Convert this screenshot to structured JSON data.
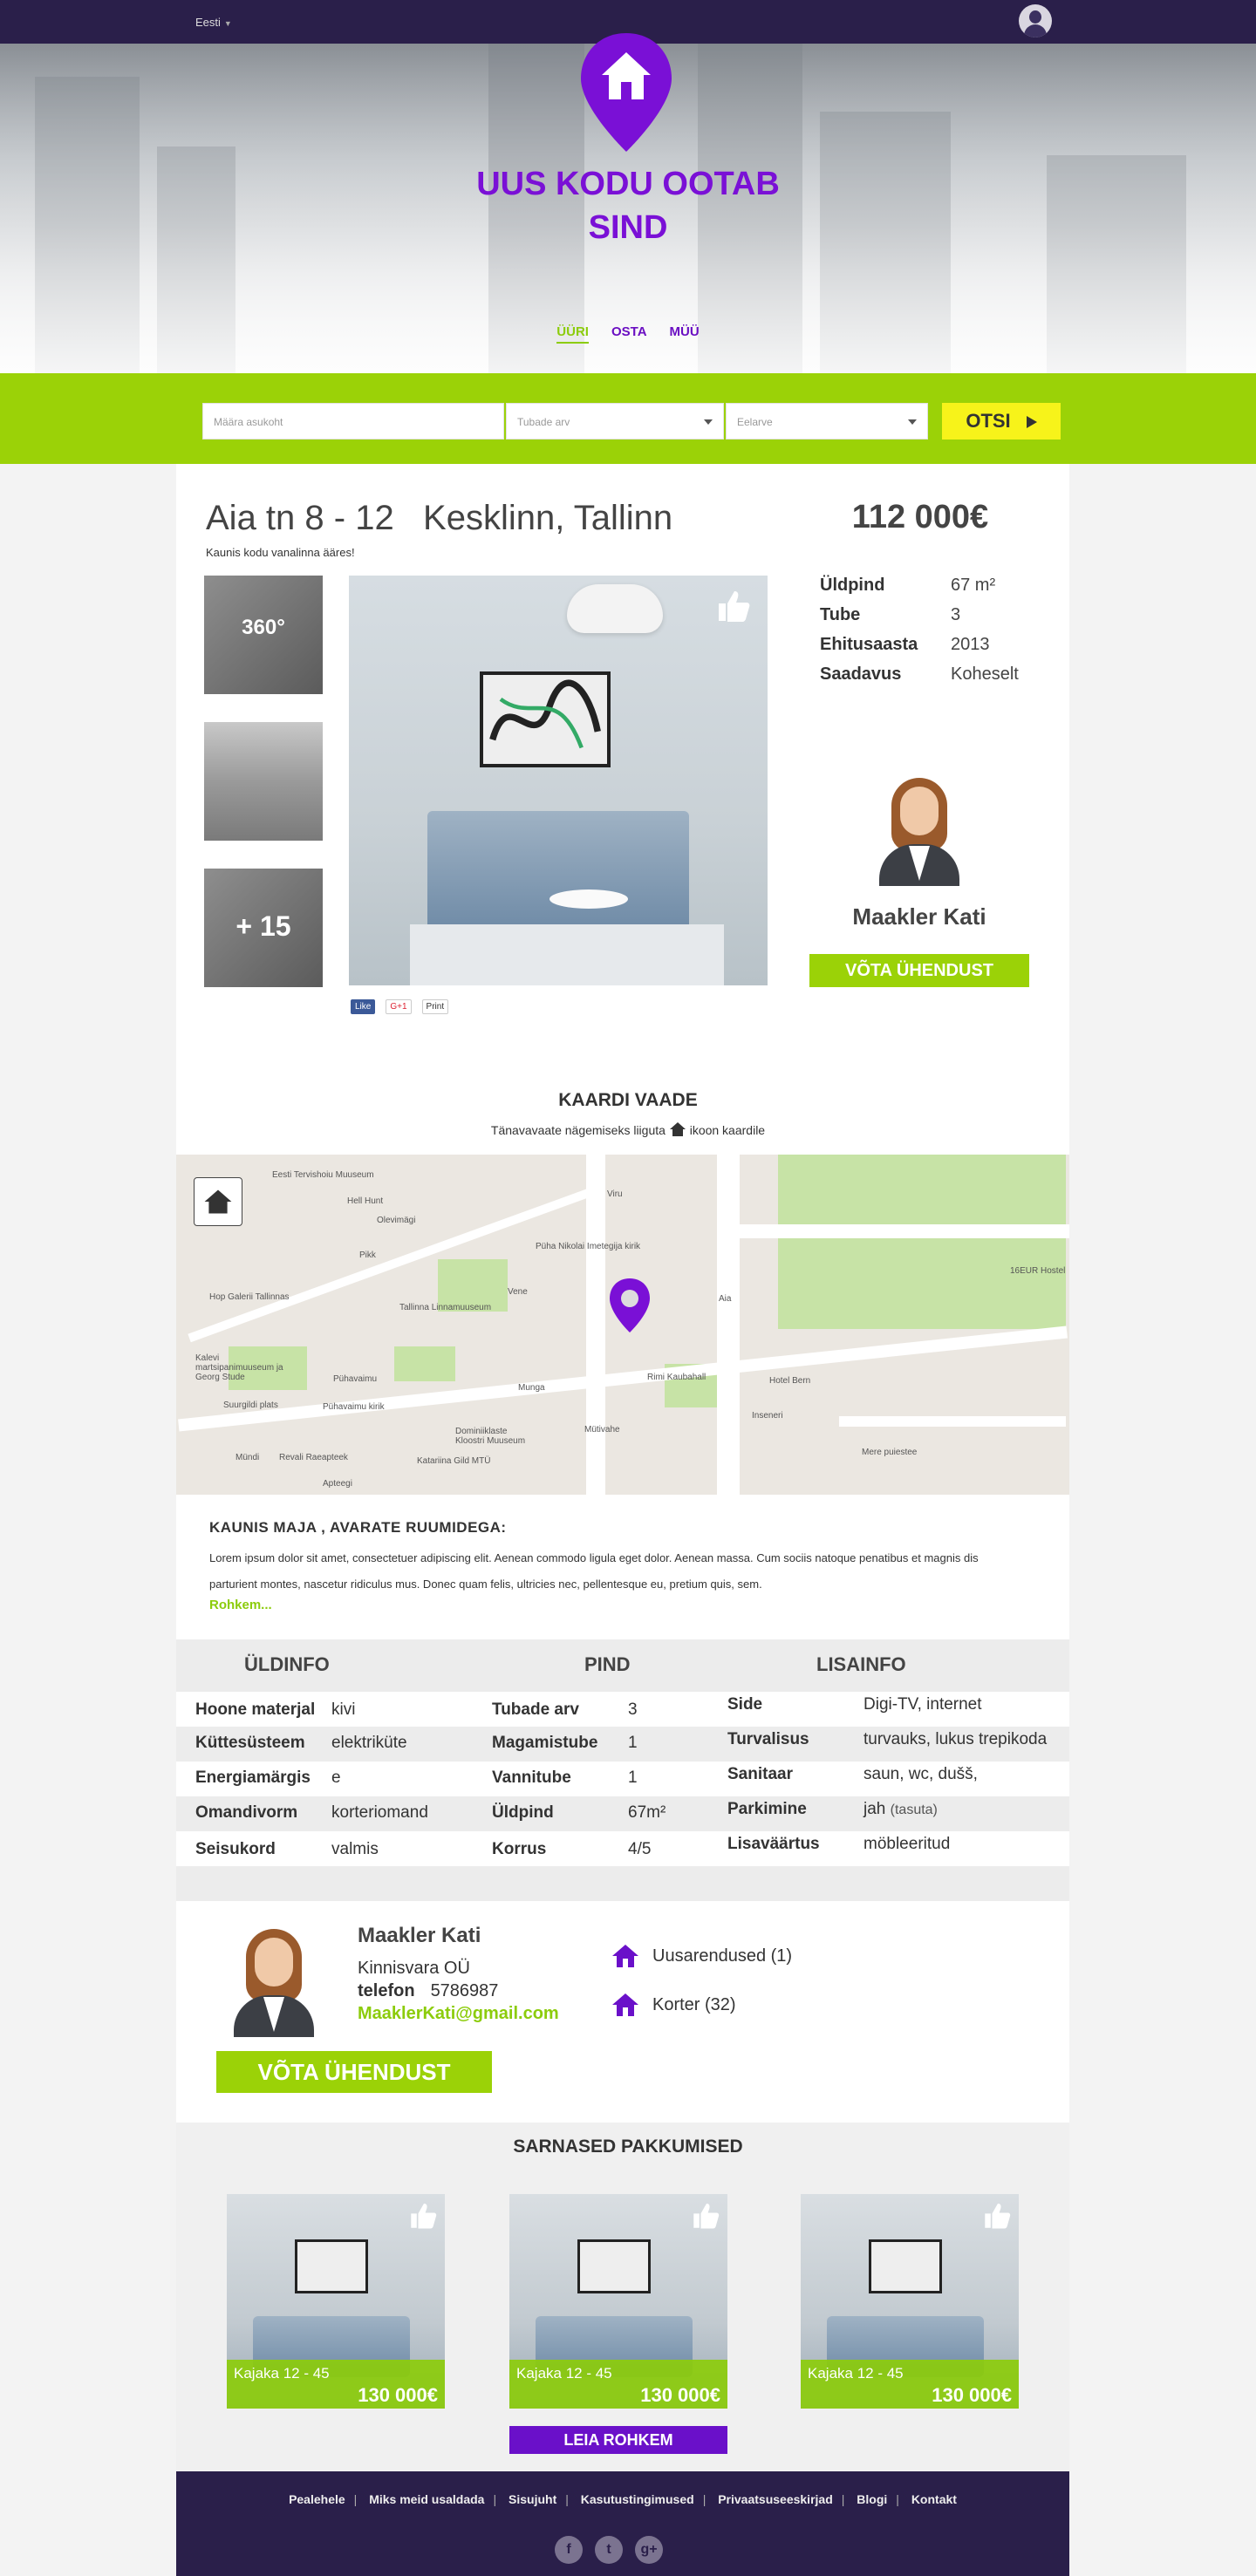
{
  "topbar": {
    "language": "Eesti"
  },
  "hero": {
    "title_line1": "UUS KODU OOTAB",
    "title_line2": "SIND",
    "tabs": [
      "ÜÜRI",
      "OSTA",
      "MÜÜ"
    ]
  },
  "search": {
    "location_placeholder": "Määra asukoht",
    "rooms_placeholder": "Tubade arv",
    "budget_placeholder": "Eelarve",
    "button": "OTSI"
  },
  "listing": {
    "street": "Aia tn 8 - 12",
    "district": "Kesklinn, Tallinn",
    "tagline": "Kaunis kodu vanalinna ääres!",
    "price": "112 000€",
    "thumb_360": "360°",
    "thumb_more": "+ 15",
    "social": [
      "Like",
      "G+1",
      "Print"
    ],
    "specs": [
      {
        "k": "Üldpind",
        "v": "67 m²"
      },
      {
        "k": "Tube",
        "v": "3"
      },
      {
        "k": "Ehitusaasta",
        "v": "2013"
      },
      {
        "k": "Saadavus",
        "v": "Koheselt"
      }
    ]
  },
  "agent": {
    "name": "Maakler Kati",
    "contact_button": "VÕTA ÜHENDUST",
    "company": "Kinnisvara OÜ",
    "phone_label": "telefon",
    "phone": "5786987",
    "email": "MaaklerKati@gmail.com",
    "card_button": "VÕTA ÜHENDUST",
    "categories": [
      "Uusarendused (1)",
      "Korter (32)"
    ]
  },
  "map": {
    "title": "KAARDI VAADE",
    "subtitle_before": "Tänavavaate nägemiseks liiguta",
    "subtitle_after": "ikoon kaardile",
    "labels": [
      "Eesti Tervishoiu Muuseum",
      "Hell Hunt",
      "Püha Nikolai Imetegija kirik",
      "Hop Galerii Tallinnas",
      "Tallinna Linnamuuseum",
      "Kalevi martsipanimuuseum ja Georg Stude",
      "Suurgildi plats",
      "Pühavaimu kirik",
      "Revali Raeapteek",
      "Dominiiklaste Kloostri Muuseum",
      "Katariina Gild MTÜ",
      "Rimi Kaubahall",
      "Hotel Bern",
      "Mere puiestee",
      "16EUR Hostel",
      "Viru",
      "Aia",
      "Munga",
      "Inseneri",
      "Mündi",
      "Apteegi",
      "Pikk",
      "Vene",
      "Olevimägi",
      "Mütivahe",
      "Pühavaimu"
    ]
  },
  "description": {
    "title": "KAUNIS MAJA , AVARATE RUUMIDEGA:",
    "text": "Lorem ipsum dolor sit amet, consectetuer adipiscing elit. Aenean commodo ligula eget dolor. Aenean massa. Cum sociis natoque penatibus et magnis dis parturient montes, nascetur ridiculus mus. Donec quam felis, ultricies nec, pellentesque eu, pretium quis, sem.",
    "more": "Rohkem..."
  },
  "info": {
    "headers": [
      "ÜLDINFO",
      "PIND",
      "LISAINFO"
    ],
    "general": [
      {
        "k": "Hoone materjal",
        "v": "kivi"
      },
      {
        "k": "Küttesüsteem",
        "v": "elektriküte"
      },
      {
        "k": "Energiamärgis",
        "v": "e"
      },
      {
        "k": "Omandivorm",
        "v": "korteriomand"
      },
      {
        "k": "Seisukord",
        "v": "valmis"
      }
    ],
    "area": [
      {
        "k": "Tubade arv",
        "v": "3"
      },
      {
        "k": "Magamistube",
        "v": "1"
      },
      {
        "k": "Vannitube",
        "v": "1"
      },
      {
        "k": "Üldpind",
        "v": "67m²"
      },
      {
        "k": "Korrus",
        "v": "4/5"
      }
    ],
    "extra": [
      {
        "k": "Side",
        "v": "Digi-TV, internet"
      },
      {
        "k": "Turvalisus",
        "v": "turvauks, lukus trepikoda"
      },
      {
        "k": "Sanitaar",
        "v": "saun, wc, dušš,"
      },
      {
        "k": "Parkimine",
        "v": "jah",
        "note": "(tasuta)"
      },
      {
        "k": "Lisaväärtus",
        "v": "möbleeritud"
      }
    ]
  },
  "similar": {
    "title": "SARNASED PAKKUMISED",
    "items": [
      {
        "address": "Kajaka 12 - 45",
        "price": "130 000€"
      },
      {
        "address": "Kajaka 12 - 45",
        "price": "130 000€"
      },
      {
        "address": "Kajaka 12 - 45",
        "price": "130 000€"
      }
    ],
    "more_button": "LEIA ROHKEM"
  },
  "footer": {
    "links": [
      "Pealehele",
      "Miks meid usaldada",
      "Sisujuht",
      "Kasutustingimused",
      "Privaatsuseeskirjad",
      "Blogi",
      "Kontakt"
    ],
    "icons": [
      "f",
      "t",
      "g+"
    ]
  },
  "colors": {
    "brand_purple": "#6a10c9",
    "brand_green": "#9bd207",
    "dark": "#2a1f4a",
    "search_button": "#f7f31a"
  }
}
